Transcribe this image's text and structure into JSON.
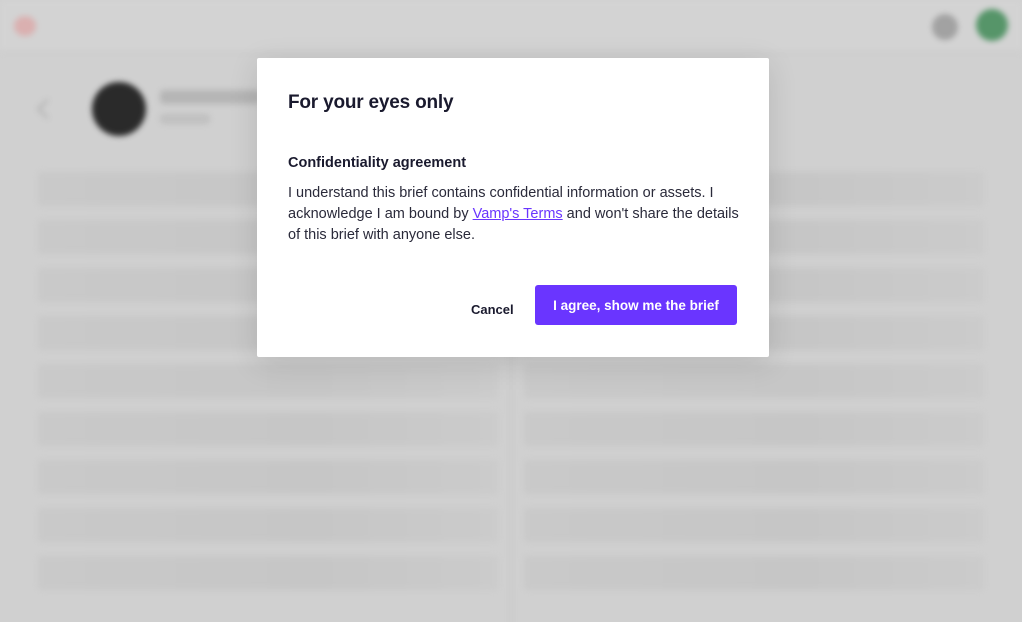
{
  "modal": {
    "title": "For your eyes only",
    "section_title": "Confidentiality agreement",
    "text_part1": "I understand this brief contains confidential information or assets. I acknowledge I am bound by ",
    "terms_link": "Vamp's Terms",
    "text_part2": " and won't share the details of this brief with anyone else.",
    "cancel_label": "Cancel",
    "agree_label": "I agree, show me the brief"
  },
  "colors": {
    "accent": "#6a35ff",
    "avatar": "#5a9c6e"
  }
}
